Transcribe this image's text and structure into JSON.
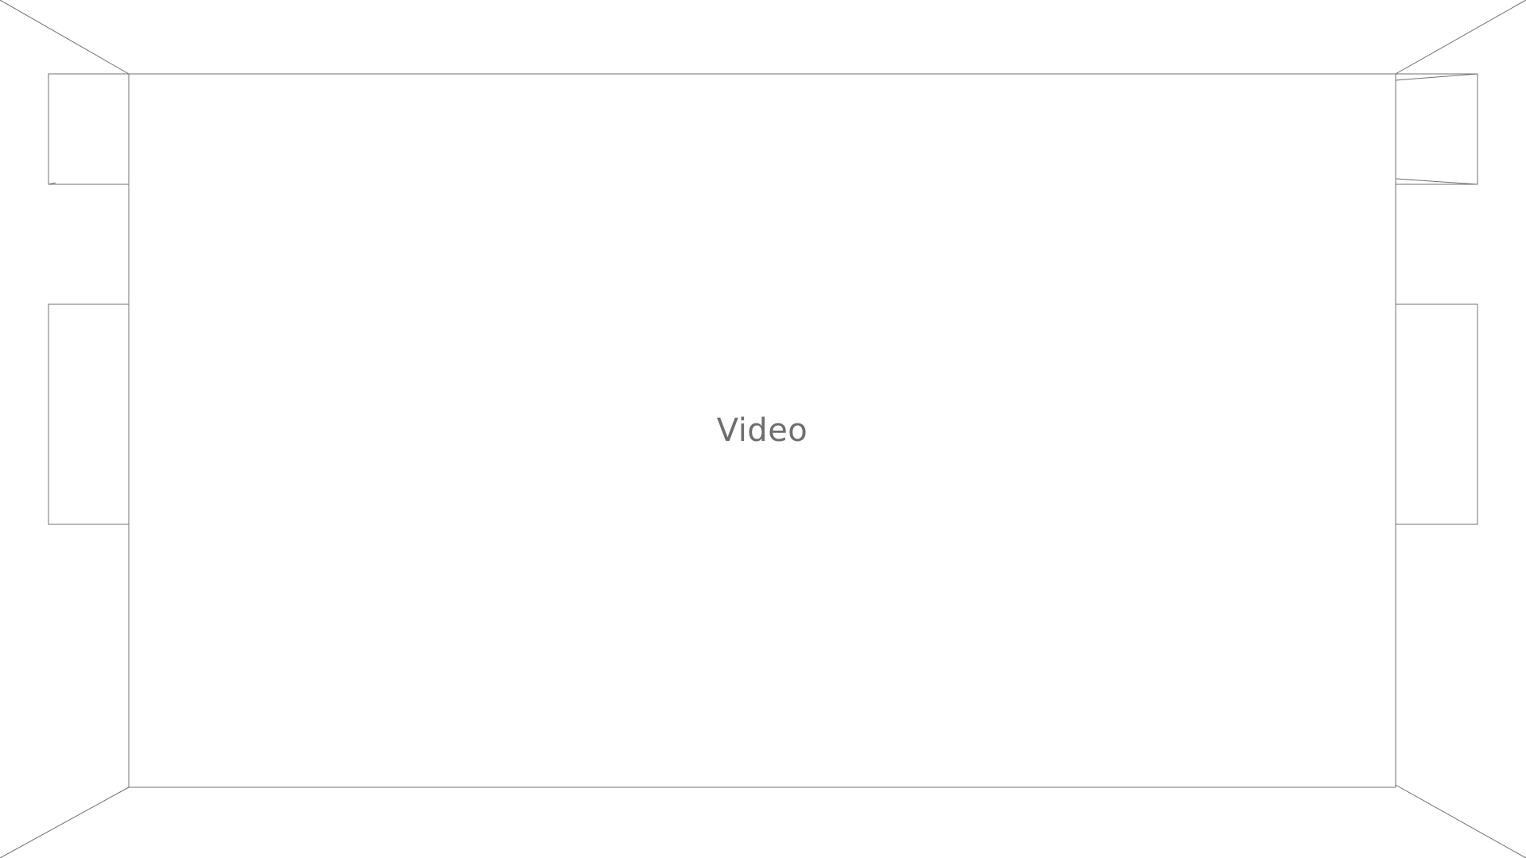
{
  "main_panel": {
    "label": "Video"
  },
  "colors": {
    "line": "#707070",
    "label": "#6e6e6e",
    "background": "#ffffff"
  }
}
